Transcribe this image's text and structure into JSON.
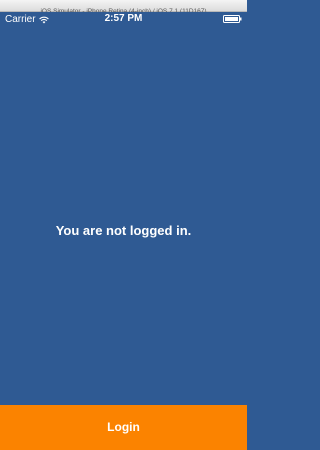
{
  "window": {
    "title": "iOS Simulator - iPhone Retina (4-inch) / iOS 7.1 (11D167)"
  },
  "status_bar": {
    "carrier": "Carrier",
    "time": "2:57 PM",
    "wifi_icon": "wifi-icon",
    "battery_icon": "battery-icon"
  },
  "main": {
    "message": "You are not logged in."
  },
  "login_button": {
    "label": "Login"
  },
  "colors": {
    "background": "#2f5a93",
    "button": "#fb8300",
    "text": "#ffffff"
  }
}
